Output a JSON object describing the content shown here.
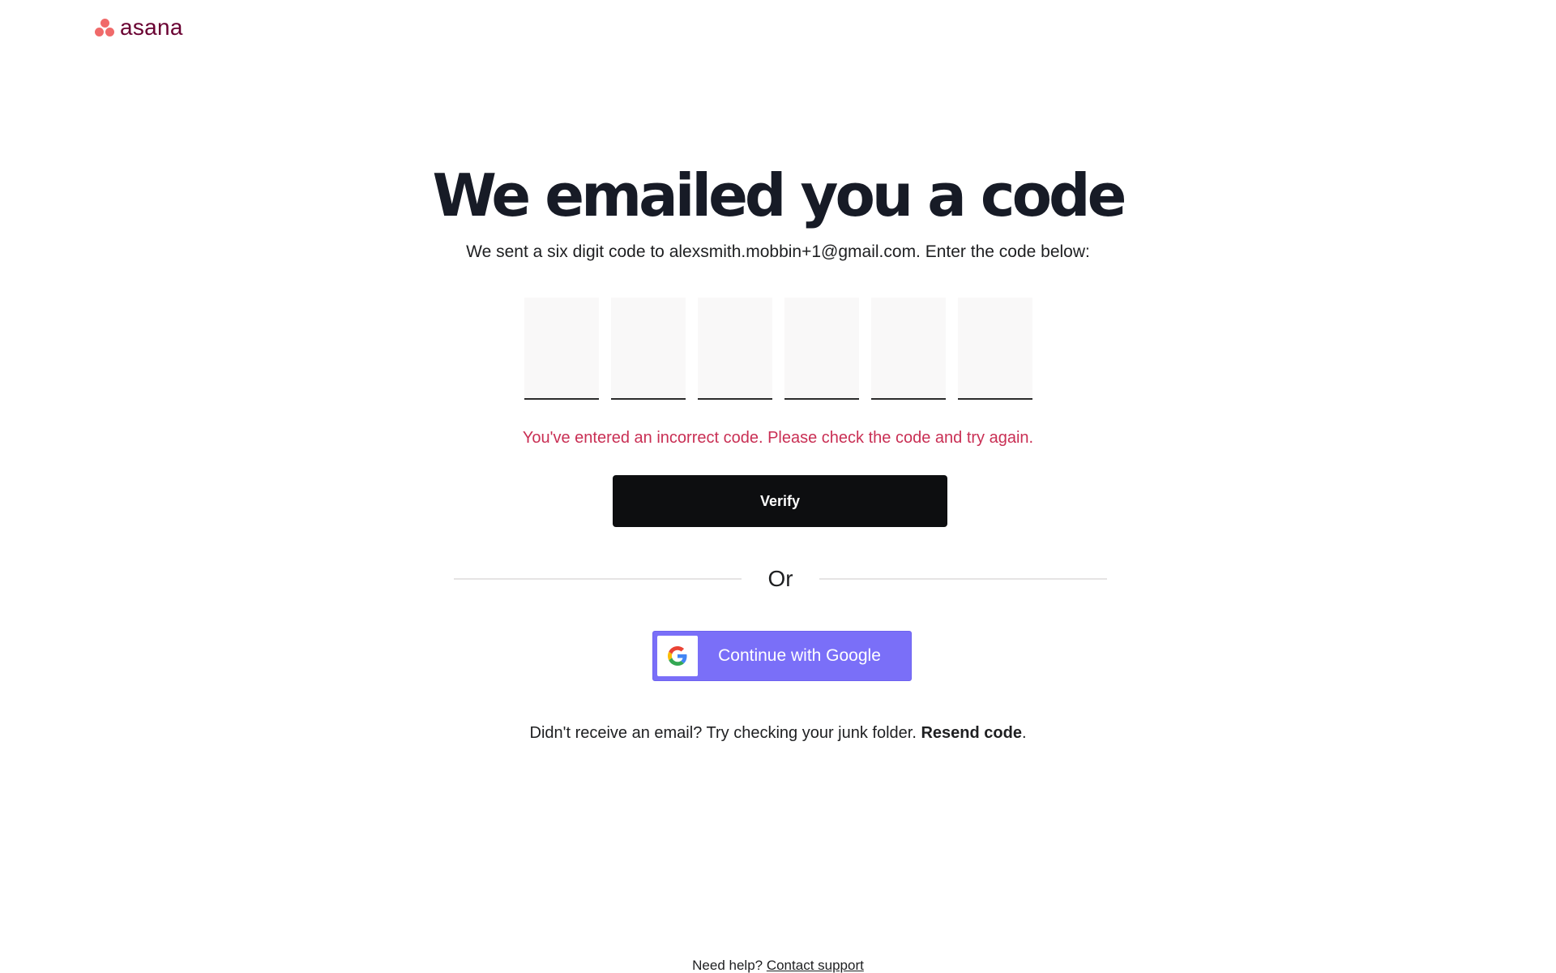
{
  "brand": {
    "name": "asana",
    "logo_color": "#f06a6a",
    "wordmark_color": "#690031"
  },
  "heading": {
    "title": "We emailed you a code",
    "subtitle": "We sent a six digit code to alexsmith.mobbin+1@gmail.com. Enter the code below:"
  },
  "code_inputs": {
    "count": 6,
    "values": [
      "",
      "",
      "",
      "",
      "",
      ""
    ]
  },
  "error": {
    "message": "You've entered an incorrect code. Please check the code and try again.",
    "color": "#c92f54"
  },
  "verify_button": {
    "label": "Verify"
  },
  "divider": {
    "label": "Or"
  },
  "google_button": {
    "label": "Continue with Google",
    "icon": "google-g-icon",
    "color": "#7a6ff8"
  },
  "resend": {
    "prefix": "Didn't receive an email? Try checking your junk folder. ",
    "link_label": "Resend code",
    "suffix": "."
  },
  "footer": {
    "help_prefix": "Need help? ",
    "help_link": "Contact support"
  }
}
